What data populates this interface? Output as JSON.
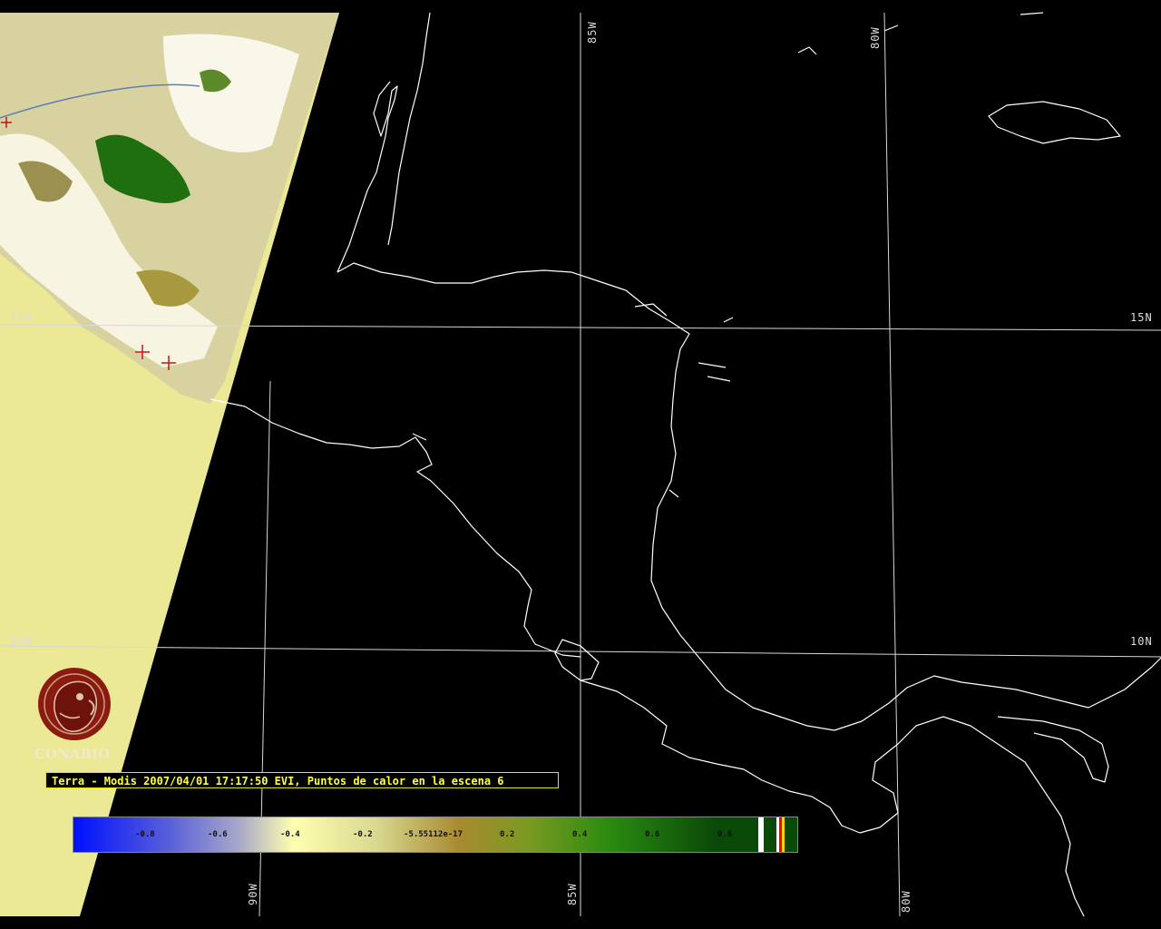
{
  "map": {
    "background": "#000000",
    "land_fill": "#ebe896",
    "coast_color": "#ffffff",
    "graticule_color": "#d8d8d8",
    "hotspot_color": "#cc1111"
  },
  "grid_labels": {
    "lon_85_top": "85W",
    "lon_80_top": "80W",
    "lat_15_left": "15N",
    "lat_15_right": "15N",
    "lat_10_left": "10N",
    "lat_10_right": "10N",
    "lon_90_bottom": "90W",
    "lon_85_bottom": "85W",
    "lon_80_bottom": "80W"
  },
  "logo": {
    "text": "CONABIO",
    "icon": "conabio-macaw-logo-icon",
    "color": "#8b1a10"
  },
  "caption": {
    "text": "Terra - Modis 2007/04/01 17:17:50 EVI, Puntos de calor en la escena 6"
  },
  "colorbar": {
    "ticks": [
      "-0.8",
      "-0.6",
      "-0.4",
      "-0.2",
      "-5.55112e-17",
      "0.2",
      "0.4",
      "0.6",
      "0.8"
    ]
  }
}
